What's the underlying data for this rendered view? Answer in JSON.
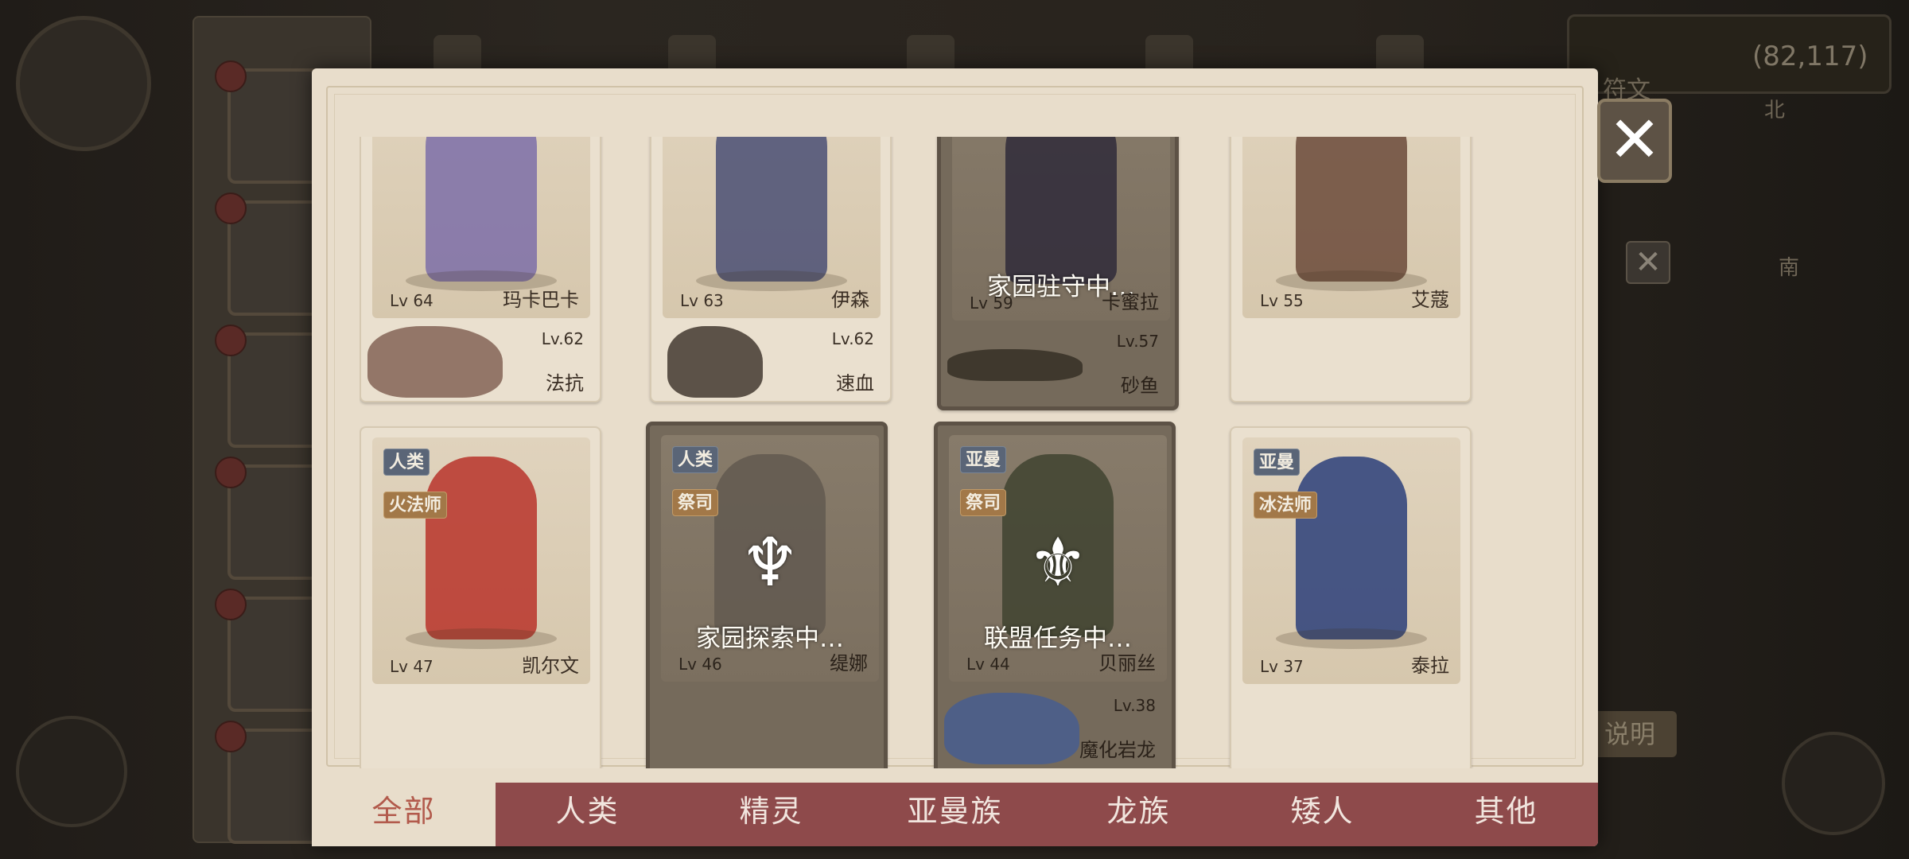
{
  "background": {
    "coordinates": "(82,117)",
    "help_label": "说明",
    "hud_labels": [
      "符文"
    ],
    "compass": [
      "北",
      "南"
    ]
  },
  "heroes_row1": [
    {
      "level": "Lv 64",
      "name": "玛卡巴卡",
      "pet_level": "Lv.62",
      "pet_name": "法抗",
      "busy": false,
      "status": "",
      "color": "#7d6fa8",
      "pet_color": "#8a6a5c"
    },
    {
      "level": "Lv 63",
      "name": "伊森",
      "pet_level": "Lv.62",
      "pet_name": "速血",
      "busy": false,
      "status": "",
      "color": "#4a4f74",
      "pet_color": "#4d4238"
    },
    {
      "level": "Lv 59",
      "name": "卡蜜拉",
      "pet_level": "Lv.57",
      "pet_name": "砂鱼",
      "busy": true,
      "status": "家园驻守中…",
      "color": "#2f2a3a",
      "pet_color": "#3a3328"
    },
    {
      "level": "Lv 55",
      "name": "艾蔻",
      "pet_level": "",
      "pet_name": "",
      "busy": false,
      "status": "",
      "color": "#6b4a3a",
      "pet_color": ""
    }
  ],
  "heroes_row2": [
    {
      "race": "人类",
      "class": "火法师",
      "level": "Lv 47",
      "name": "凯尔文",
      "busy": false,
      "status": "",
      "pet_level": "",
      "pet_name": "",
      "color": "#b8342a",
      "pet_color": ""
    },
    {
      "race": "人类",
      "class": "祭司",
      "level": "Lv 46",
      "name": "缇娜",
      "busy": true,
      "status": "家园探索中…",
      "pet_level": "",
      "pet_name": "",
      "color": "#615950",
      "pet_color": ""
    },
    {
      "race": "亚曼",
      "class": "祭司",
      "level": "Lv 44",
      "name": "贝丽丝",
      "busy": true,
      "status": "联盟任务中…",
      "pet_level": "Lv.38",
      "pet_name": "魔化岩龙",
      "color": "#3f4330",
      "pet_color": "#4a5e8c"
    },
    {
      "race": "亚曼",
      "class": "冰法师",
      "level": "Lv 37",
      "name": "泰拉",
      "busy": false,
      "status": "",
      "pet_level": "",
      "pet_name": "",
      "color": "#2c3f7a",
      "pet_color": ""
    }
  ],
  "tabs": [
    "全部",
    "人类",
    "精灵",
    "亚曼族",
    "龙族",
    "矮人",
    "其他"
  ],
  "active_tab": "全部",
  "close_label": "✕",
  "colors": {
    "tab_bar": "#8e4a4b",
    "tab_active_text": "#b25a4c",
    "modal_bg": "#e8ddcb"
  }
}
